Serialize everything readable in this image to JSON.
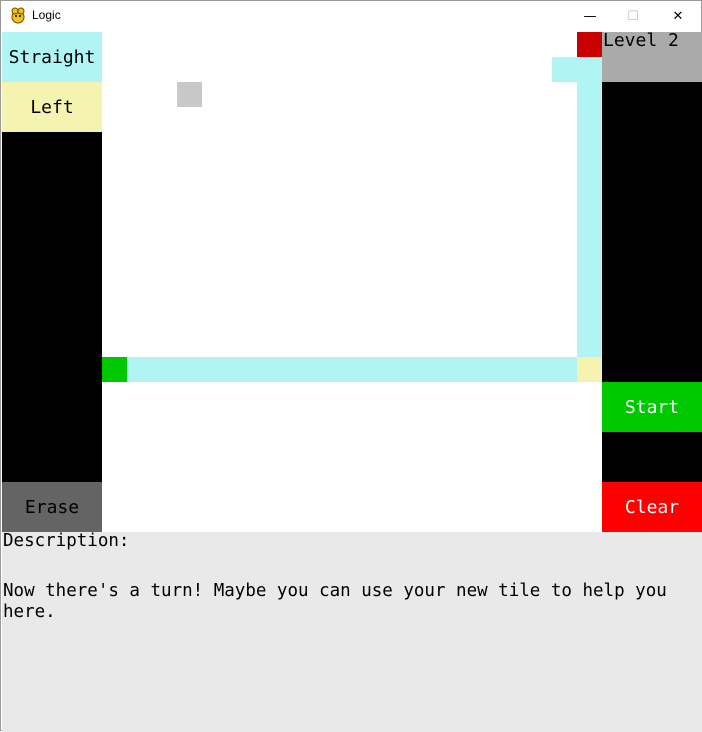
{
  "window": {
    "title": "Logic",
    "app_icon": "pygame-snake-icon",
    "minimize_glyph": "—",
    "maximize_glyph": "☐",
    "close_glyph": "✕"
  },
  "tile_palette": {
    "straight_label": "Straight",
    "left_label": "Left",
    "erase_label": "Erase"
  },
  "level": {
    "label": "Level 2"
  },
  "controls": {
    "start_label": "Start",
    "clear_label": "Clear"
  },
  "description": {
    "heading": "Description:",
    "text": "Now there's a turn! Maybe you can use your new tile to help you here."
  },
  "colors": {
    "straight_tile": "#b0f4f4",
    "left_tile": "#f4f4b0",
    "start_marker": "#00c800",
    "goal_marker": "#c80000",
    "cursor_tile": "#c8c8c8",
    "start_button": "#00c800",
    "clear_button": "#ff0000",
    "erase_button": "#646464",
    "level_panel": "#aaaaaa",
    "sidebar": "#000000",
    "description_bg": "#e9e9e9"
  }
}
